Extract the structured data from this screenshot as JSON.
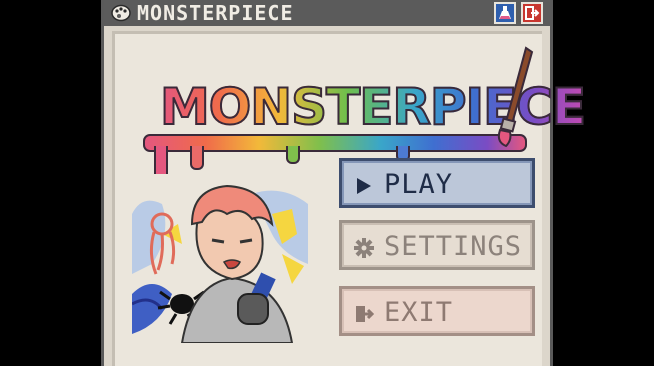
{
  "window": {
    "title": "MONSTERPIECE"
  },
  "logo": {
    "text": "MONSTERPIECE"
  },
  "menu": {
    "play_label": "PLAY",
    "settings_label": "SETTINGS",
    "exit_label": "EXIT"
  },
  "colors": {
    "titlebar": "#5b5b5b",
    "window_bg": "#dcd6cb",
    "play_bg": "#bcc7d9",
    "settings_bg": "#e6ddd2",
    "exit_bg": "#ecd7cd",
    "lab_button": "#2f5fae",
    "exit_button": "#c8362f"
  },
  "icons": {
    "title": "paint-palette-icon",
    "lab": "flask-icon",
    "exit_window": "exit-door-icon",
    "play": "play-triangle-icon",
    "settings": "gear-icon",
    "exit": "exit-arrow-icon"
  }
}
